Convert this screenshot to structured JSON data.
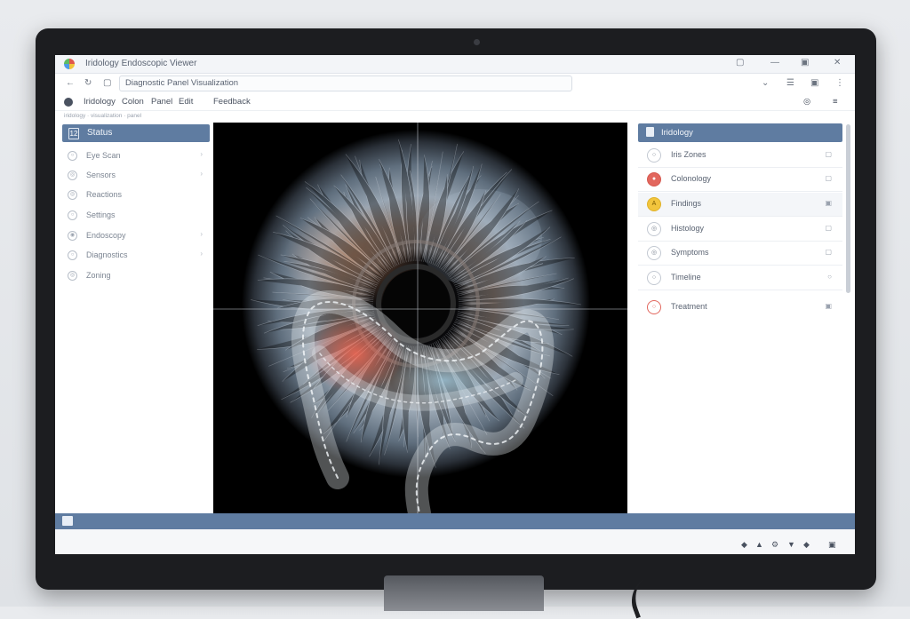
{
  "window": {
    "title": "Iridology Endoscopic Viewer",
    "controls": [
      "▢",
      "—",
      "▣",
      "✕"
    ]
  },
  "address_bar": {
    "back": "←",
    "reload": "↻",
    "home": "▢",
    "url": "Diagnostic Panel Visualization",
    "actions": [
      "⌄",
      "☰",
      "▣",
      "⋮"
    ]
  },
  "menubar": {
    "items": [
      "Iridology",
      "Colon",
      "Panel",
      "Edit",
      "Feedback"
    ],
    "right_actions": [
      "◎",
      "≡"
    ]
  },
  "breadcrumb": "iridology · visualization · panel",
  "sidebar": {
    "header": "Status",
    "header_icon": "12",
    "items": [
      {
        "label": "Eye Scan",
        "icon": "○"
      },
      {
        "label": "Sensors",
        "icon": "◎"
      },
      {
        "label": "Reactions",
        "icon": "◎"
      },
      {
        "label": "Settings",
        "icon": "○"
      },
      {
        "label": "Endoscopy",
        "icon": "◉"
      },
      {
        "label": "Diagnostics",
        "icon": "○"
      },
      {
        "label": "Zoning",
        "icon": "◎"
      }
    ]
  },
  "viewer": {
    "alt": "iris-colon-overlay"
  },
  "right_panel": {
    "header": "Iridology",
    "items": [
      {
        "label": "Iris Zones",
        "icon": "○",
        "color": "#ffffff",
        "action": "▢"
      },
      {
        "label": "Colonology",
        "icon": "●",
        "color": "#e2675e",
        "action": "▢"
      },
      {
        "label": "Findings",
        "icon": "A",
        "color": "#f2c53d",
        "action": "▣"
      },
      {
        "label": "Histology",
        "icon": "◎",
        "color": "#ffffff",
        "action": "▢"
      },
      {
        "label": "Symptoms",
        "icon": "◎",
        "color": "#ffffff",
        "action": "▢"
      },
      {
        "label": "Timeline",
        "icon": "○",
        "color": "#ffffff",
        "action": "○"
      },
      {
        "label": "Treatment",
        "icon": "○",
        "color": "#ffffff",
        "action": "▣"
      }
    ]
  },
  "status_bar": {
    "tray": [
      "◆",
      "▲",
      "⚙",
      "▼",
      "◆",
      "▣"
    ]
  },
  "colors": {
    "accent": "#5f7ca1",
    "highlight_red": "#ff6a55",
    "highlight_blue": "#a8d8f0"
  }
}
